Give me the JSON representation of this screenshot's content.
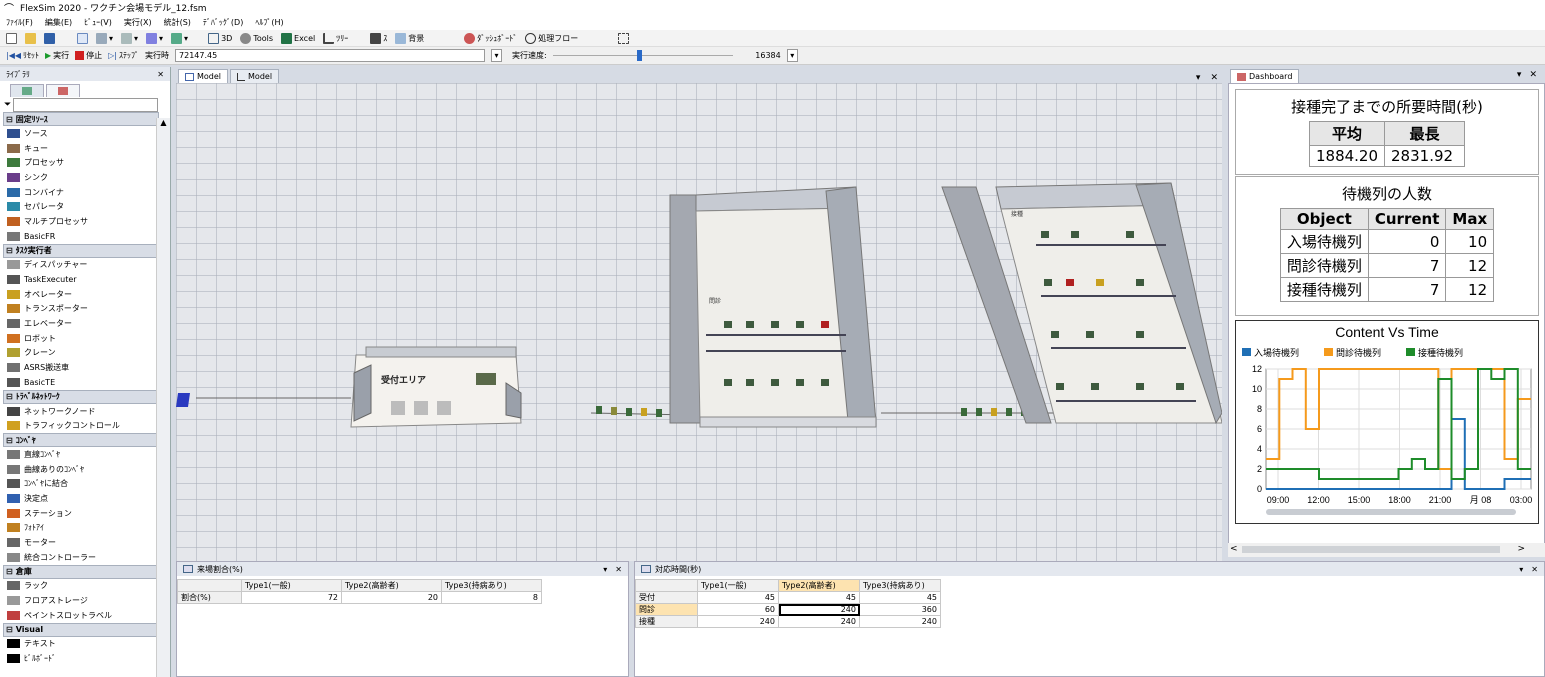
{
  "window": {
    "title": "FlexSim 2020 - ワクチン会場モデル_12.fsm"
  },
  "menu": [
    "ﾌｧｲﾙ(F)",
    "編集(E)",
    "ﾋﾞｭｰ(V)",
    "実行(X)",
    "統計(S)",
    "ﾃﾞﾊﾞｯｸﾞ(D)",
    "ﾍﾙﾌﾟ(H)"
  ],
  "toolbar": {
    "3d": "3D",
    "tools": "Tools",
    "excel": "Excel",
    "tree": "ﾂﾘｰ",
    "script": "ｽ",
    "background": "背景",
    "dashboard": "ﾀﾞｯｼｭﾎﾞｰﾄﾞ",
    "process_flow": "処理フロー"
  },
  "runbar": {
    "reset": "ﾘｾｯﾄ",
    "run": "実行",
    "stop": "停止",
    "step": "ｽﾃｯﾌﾟ",
    "run_time_label": "実行時",
    "run_time_value": "72147.45",
    "speed_label": "実行速度:",
    "speed_value": "16384",
    "speed_fraction": 0.48
  },
  "library": {
    "title": "ﾗｲﾌﾞﾗﾘ",
    "categories": [
      {
        "name": "固定ﾘｿｰｽ",
        "items": [
          {
            "label": "ソース",
            "color": "#2f4f8f"
          },
          {
            "label": "キュー",
            "color": "#8b6a4a"
          },
          {
            "label": "プロセッサ",
            "color": "#3d7a3d"
          },
          {
            "label": "シンク",
            "color": "#6a3d8a"
          },
          {
            "label": "コンバイナ",
            "color": "#2a6aa8"
          },
          {
            "label": "セパレータ",
            "color": "#2a8aa8"
          },
          {
            "label": "マルチプロセッサ",
            "color": "#c06020"
          },
          {
            "label": "BasicFR",
            "color": "#777777"
          }
        ]
      },
      {
        "name": "ﾀｽｸ実行者",
        "items": [
          {
            "label": "ディスパッチャー",
            "color": "#999999"
          },
          {
            "label": "TaskExecuter",
            "color": "#555555"
          },
          {
            "label": "オペレーター",
            "color": "#c9a020"
          },
          {
            "label": "トランスポーター",
            "color": "#c08020"
          },
          {
            "label": "エレベーター",
            "color": "#666666"
          },
          {
            "label": "ロボット",
            "color": "#d07020"
          },
          {
            "label": "クレーン",
            "color": "#b0a030"
          },
          {
            "label": "ASRS搬送車",
            "color": "#707070"
          },
          {
            "label": "BasicTE",
            "color": "#555555"
          }
        ]
      },
      {
        "name": "ﾄﾗﾍﾞﾙﾈｯﾄﾜｰｸ",
        "items": [
          {
            "label": "ネットワークノード",
            "color": "#444444"
          },
          {
            "label": "トラフィックコントロール",
            "color": "#d0a020"
          }
        ]
      },
      {
        "name": "ｺﾝﾍﾞﾔ",
        "items": [
          {
            "label": "直線ｺﾝﾍﾞﾔ",
            "color": "#777777"
          },
          {
            "label": "曲線ありのｺﾝﾍﾞﾔ",
            "color": "#777777"
          },
          {
            "label": "ｺﾝﾍﾞﾔに結合",
            "color": "#555555"
          },
          {
            "label": "決定点",
            "color": "#3060b0"
          },
          {
            "label": "ステーション",
            "color": "#d06020"
          },
          {
            "label": "ﾌｫﾄｱｲ",
            "color": "#c08020"
          },
          {
            "label": "モーター",
            "color": "#666666"
          },
          {
            "label": "統合コントローラー",
            "color": "#888888"
          }
        ]
      },
      {
        "name": "倉庫",
        "items": [
          {
            "label": "ラック",
            "color": "#666666"
          },
          {
            "label": "フロアストレージ",
            "color": "#999999"
          },
          {
            "label": "ペイントスロットラベル",
            "color": "#c04040"
          }
        ]
      },
      {
        "name": "Visual",
        "items": [
          {
            "label": "テキスト",
            "color": "#000000"
          },
          {
            "label": "ﾋﾞﾙﾎﾞｰﾄﾞ",
            "color": "#000000"
          }
        ]
      }
    ]
  },
  "view_tabs": [
    "Model",
    "Model"
  ],
  "model": {
    "reception_label": "受付エリア",
    "exam_label": "問診",
    "vacc_label": "接種"
  },
  "dashboard": {
    "tab": "Dashboard",
    "time_panel": {
      "title": "接種完了までの所要時間(秒)",
      "headers": [
        "平均",
        "最長"
      ],
      "values": [
        "1884.20",
        "2831.92"
      ]
    },
    "queue_panel": {
      "title": "待機列の人数",
      "headers": [
        "Object",
        "Current",
        "Max"
      ],
      "rows": [
        [
          "入場待機列",
          "0",
          "10"
        ],
        [
          "問診待機列",
          "7",
          "12"
        ],
        [
          "接種待機列",
          "7",
          "12"
        ]
      ]
    }
  },
  "chart_data": {
    "type": "line",
    "title": "Content Vs Time",
    "legend_position": "top-left",
    "grid": true,
    "ylim": [
      0,
      12
    ],
    "yticks": [
      "0",
      "2",
      "4",
      "6",
      "8",
      "10",
      "12"
    ],
    "xticks": [
      "09:00",
      "12:00",
      "15:00",
      "18:00",
      "21:00",
      "月 08",
      "03:00"
    ],
    "x_count": 20,
    "series": [
      {
        "name": "入場待機列",
        "color": "#1f6fb5",
        "values": [
          0,
          0,
          0,
          0,
          0,
          0,
          0,
          0,
          0,
          0,
          0,
          0,
          0,
          0,
          7,
          0,
          0,
          0,
          1,
          1
        ]
      },
      {
        "name": "問診待機列",
        "color": "#f59a1c",
        "values": [
          3,
          11,
          12,
          6,
          12,
          12,
          12,
          12,
          12,
          12,
          12,
          12,
          12,
          2,
          12,
          12,
          12,
          12,
          3,
          9
        ]
      },
      {
        "name": "接種待機列",
        "color": "#1e8c2a",
        "values": [
          2,
          2,
          2,
          2,
          1,
          1,
          1,
          1,
          1,
          1,
          2,
          3,
          2,
          11,
          1,
          2,
          12,
          11,
          12,
          2
        ]
      }
    ]
  },
  "table_arrival": {
    "title": "来場割合(%)",
    "headers": [
      "",
      "Type1(一般)",
      "Type2(高齢者)",
      "Type3(持病あり)"
    ],
    "rows": [
      [
        "割合(%)",
        "72",
        "20",
        "8"
      ]
    ]
  },
  "table_time": {
    "title": "対応時間(秒)",
    "headers": [
      "",
      "Type1(一般)",
      "Type2(高齢者)",
      "Type3(持病あり)"
    ],
    "rows": [
      [
        "受付",
        "45",
        "45",
        "45"
      ],
      [
        "問診",
        "60",
        "240",
        "360"
      ],
      [
        "接種",
        "240",
        "240",
        "240"
      ]
    ]
  }
}
